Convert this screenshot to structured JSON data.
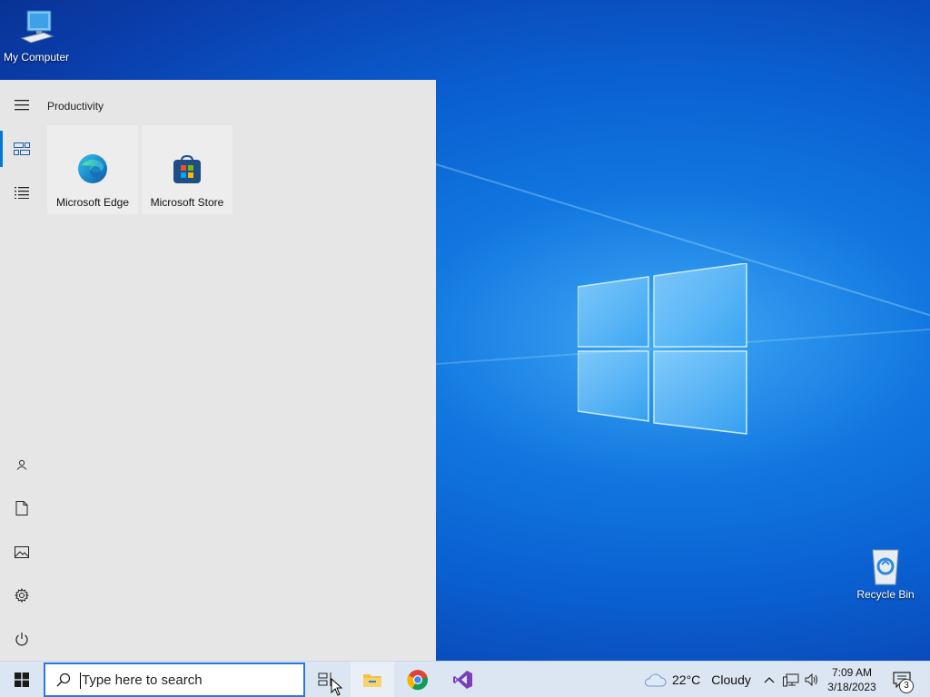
{
  "desktop": {
    "icons": [
      {
        "label": "My Computer",
        "icon": "computer-icon"
      },
      {
        "label": "Recycle Bin",
        "icon": "recycle-bin-icon"
      }
    ]
  },
  "start_menu": {
    "rail": [
      {
        "icon": "hamburger-menu-icon"
      },
      {
        "icon": "tiles-view-icon",
        "active": true
      },
      {
        "icon": "all-apps-list-icon"
      },
      {
        "icon": "user-icon"
      },
      {
        "icon": "documents-icon"
      },
      {
        "icon": "pictures-icon"
      },
      {
        "icon": "settings-gear-icon"
      },
      {
        "icon": "power-icon"
      }
    ],
    "group_title": "Productivity",
    "tiles": [
      {
        "label": "Microsoft Edge",
        "icon": "edge-icon"
      },
      {
        "label": "Microsoft Store",
        "icon": "store-icon"
      }
    ]
  },
  "taskbar": {
    "search": {
      "placeholder": "Type here to search"
    },
    "pinned": [
      {
        "icon": "task-view-icon"
      },
      {
        "icon": "file-explorer-icon"
      },
      {
        "icon": "chrome-icon"
      },
      {
        "icon": "visual-studio-icon"
      }
    ],
    "weather": {
      "temp": "22°C",
      "condition": "Cloudy"
    },
    "clock": {
      "time": "7:09 AM",
      "date": "3/18/2023"
    },
    "notifications": {
      "count": "3"
    }
  },
  "colors": {
    "accent": "#0078d7",
    "taskbar": "#dce6f2",
    "start_bg": "#e6e6e6"
  }
}
